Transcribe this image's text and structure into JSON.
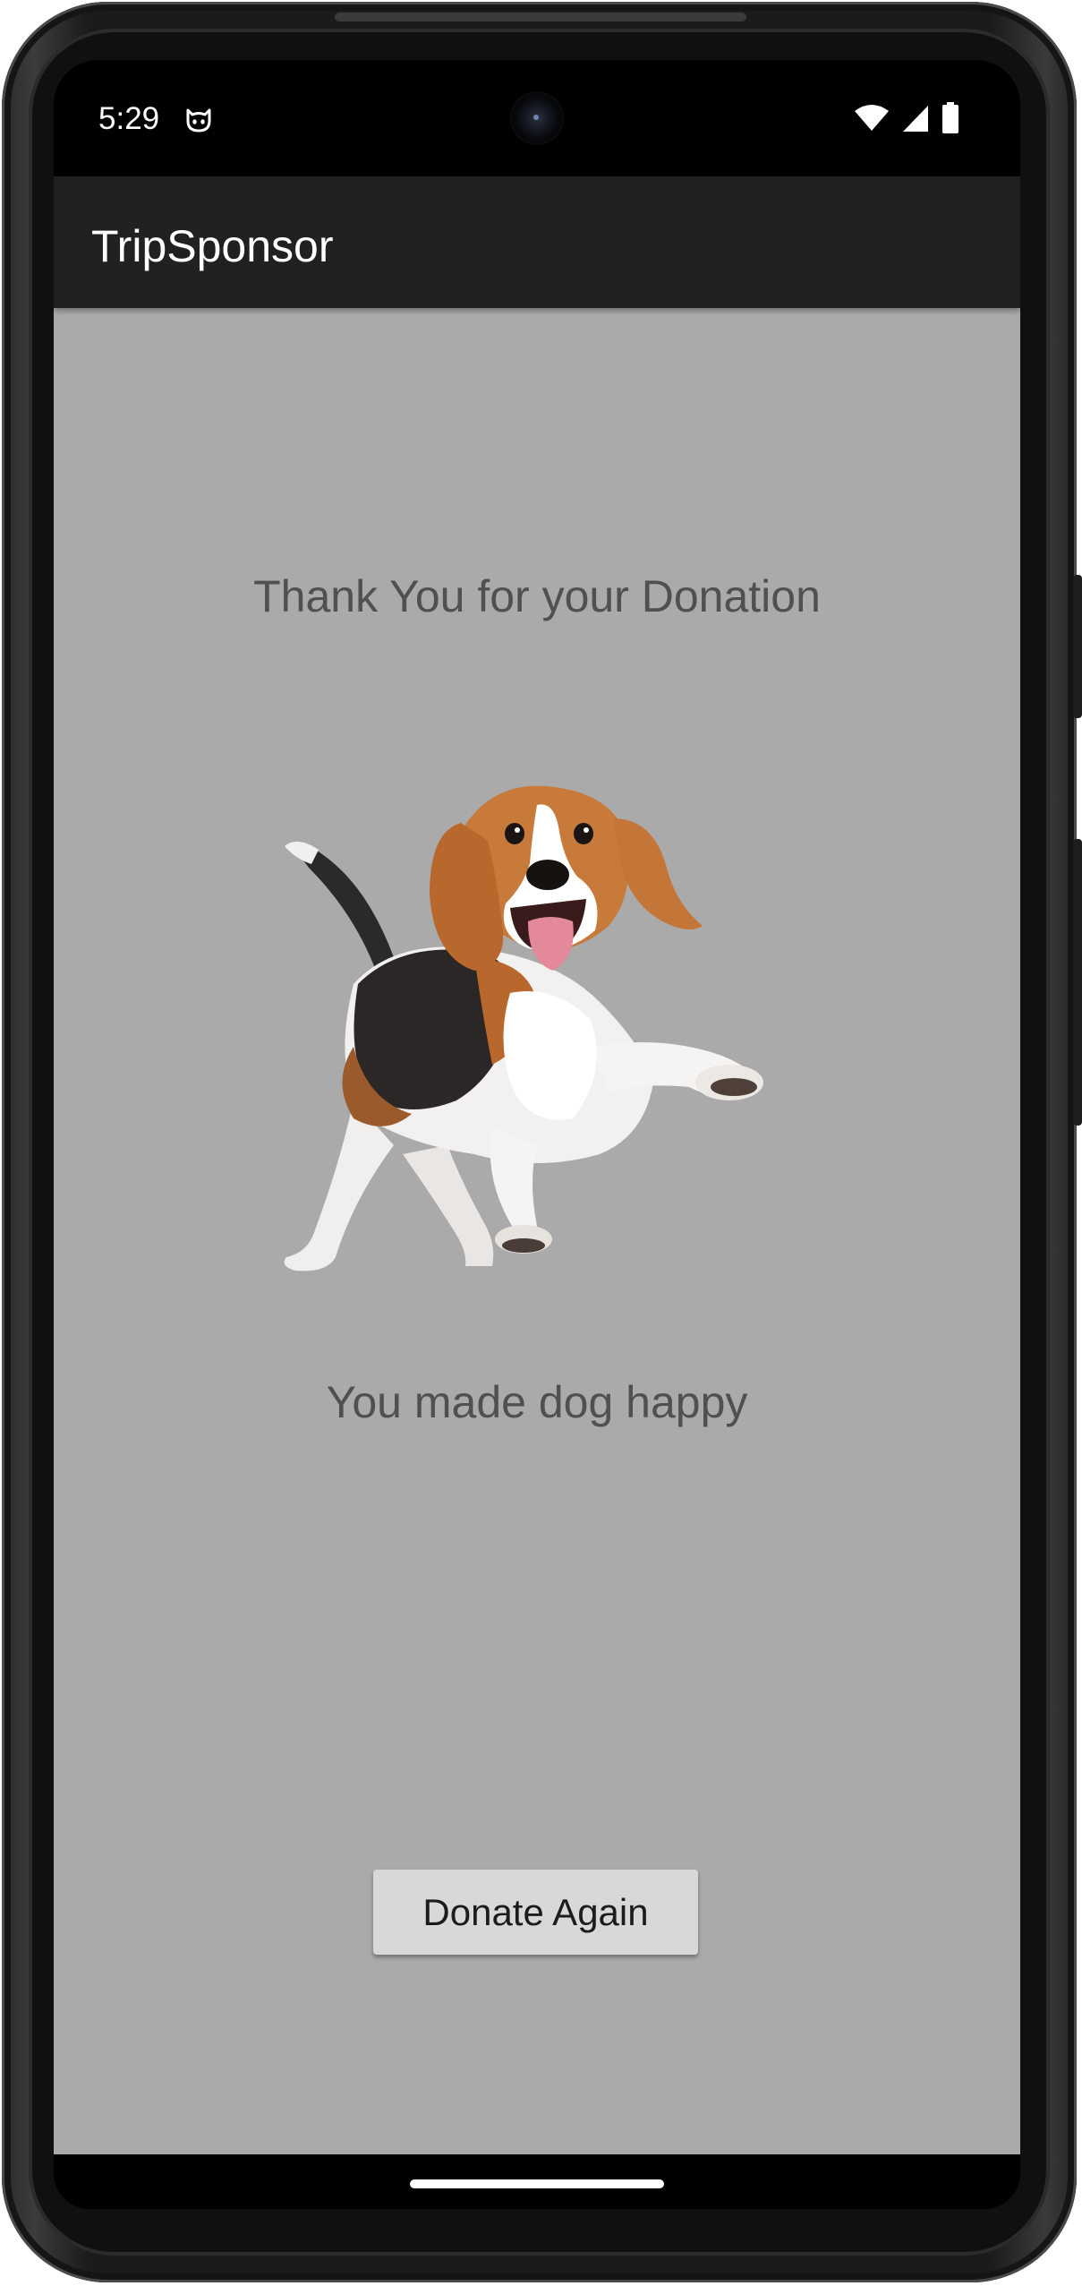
{
  "status_bar": {
    "time": "5:29",
    "notification_icon": "cat-face-icon",
    "icons": [
      "wifi-icon",
      "cell-signal-icon",
      "battery-icon"
    ]
  },
  "app_bar": {
    "title": "TripSponsor"
  },
  "main": {
    "heading": "Thank You for your Donation",
    "image": "beagle-dog-image",
    "message": "You made dog happy",
    "donate_again_label": "Donate Again"
  },
  "colors": {
    "app_bar": "#212121",
    "background": "#aaaaaa",
    "text": "#505050",
    "button": "#d8d8d8"
  }
}
